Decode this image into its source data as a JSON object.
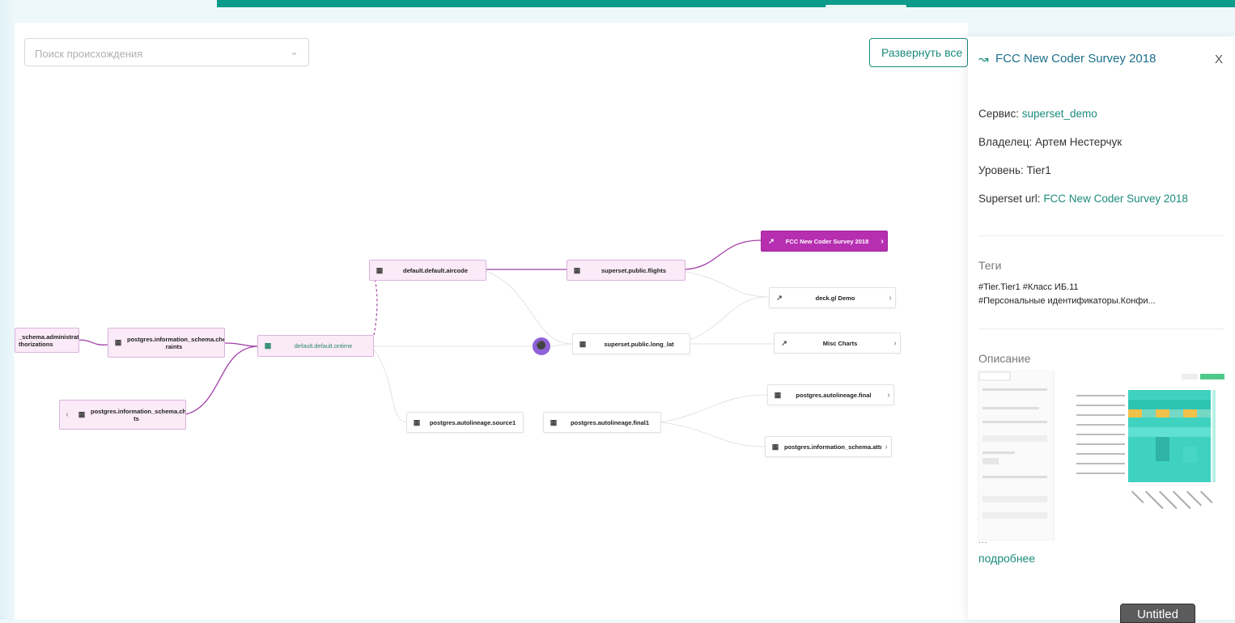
{
  "search": {
    "placeholder": "Поиск происхождения"
  },
  "toolbar": {
    "expand_label": "Развернуть все"
  },
  "nodes": {
    "admin_auth": {
      "label": "_schema.administrati\nthorizations"
    },
    "check_constraints": {
      "label": "postgres.information_schema.check_const\nraints"
    },
    "character_sets": {
      "label": "postgres.information_schema.character_se\nts"
    },
    "airmode": {
      "label": "default.default.aircode"
    },
    "ontime": {
      "label": "default.default.ontime"
    },
    "source1": {
      "label": "postgres.autolineage.source1"
    },
    "flights": {
      "label": "superset.public.flights"
    },
    "long_lat": {
      "label": "superset.public.long_lat"
    },
    "final1": {
      "label": "postgres.autolineage.final1"
    },
    "fcc": {
      "label": "FCC New Coder Survey 2018"
    },
    "deckgl": {
      "label": "deck.gl Demo"
    },
    "misc": {
      "label": "Misc Charts"
    },
    "final": {
      "label": "postgres.autolineage.final"
    },
    "attributes": {
      "label": "postgres.information_schema.attributes"
    }
  },
  "panel": {
    "title": "FCC New Coder Survey 2018",
    "close": "X",
    "service_label": "Сервис:",
    "service_value": "superset_demo",
    "owner_label": "Владелец:",
    "owner_value": "Артем Нестерчук",
    "tier_label": "Уровень:",
    "tier_value": "Tier1",
    "url_label": "Superset url:",
    "url_value": "FCC New Coder Survey 2018",
    "tags_heading": "Теги",
    "tags_line1": "#Tier.Tier1  #Класс ИБ.11",
    "tags_line2": "#Персональные идентификаторы.Конфи...",
    "description_heading": "Описание",
    "ellipsis": "...",
    "more_link": "подробнее"
  },
  "tooltip": {
    "text": "Untitled"
  },
  "colors": {
    "accent": "#1b8b7b",
    "topbar": "#0d9b8b",
    "active_node": "#b62fb1",
    "lineage_edge": "#a23ea6",
    "hub": "#8e62d9"
  },
  "icons": {
    "table": "table-icon",
    "chart": "chart-icon",
    "hub": "lineage-hub-icon"
  }
}
